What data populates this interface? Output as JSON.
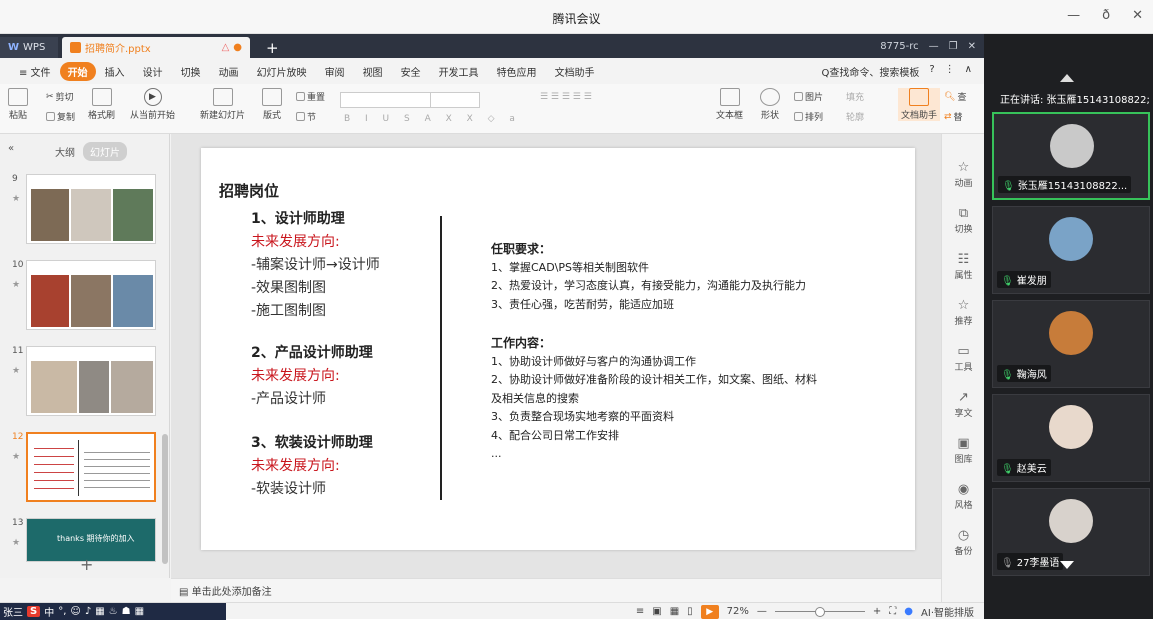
{
  "window": {
    "title": "腾讯会议",
    "controls": [
      "—",
      "ð",
      "✕"
    ]
  },
  "wps": {
    "app_tab": "WPS",
    "doc_tab": "招聘简介.pptx",
    "new_tab": "+",
    "tabbar_right": [
      "8775-rc",
      "—",
      "❐",
      "✕"
    ],
    "menu": [
      "≡ 文件",
      "开始",
      "插入",
      "设计",
      "切换",
      "动画",
      "幻灯片放映",
      "审阅",
      "视图",
      "安全",
      "开发工具",
      "特色应用",
      "文档助手"
    ],
    "menu_active": "开始",
    "menu_right": [
      "Q查找命令、搜索模板",
      "?",
      "⋮",
      "∧"
    ],
    "ribbon": {
      "paste": "粘贴",
      "cut": "剪切",
      "copy": "复制",
      "format_painter": "格式刷",
      "from_current": "从当前开始",
      "new_slide": "新建幻灯片",
      "layout": "版式",
      "section": "节",
      "reset": "重置",
      "text_box": "文本框",
      "shape": "形状",
      "picture": "图片",
      "arrange": "排列",
      "fill": "填充",
      "outline": "轮廓",
      "doc_assistant": "文档助手",
      "find": "查",
      "replace": "替"
    },
    "left_panel": {
      "collapse": "«",
      "outline_label": "大纲",
      "slides_label": "幻灯片",
      "slides": [
        {
          "num": "9",
          "star": "★"
        },
        {
          "num": "10",
          "star": "★"
        },
        {
          "num": "11",
          "star": "★"
        },
        {
          "num": "12",
          "star": "★",
          "selected": true
        },
        {
          "num": "13",
          "star": "★",
          "thumb_text": "thanks 期待你的加入"
        }
      ],
      "add": "+"
    },
    "slide": {
      "title": "招聘岗位",
      "jobs": [
        {
          "heading": "1、设计师助理",
          "direction": "未来发展方向:",
          "items": [
            "-辅案设计师→设计师",
            "-效果图制图",
            "-施工图制图"
          ]
        },
        {
          "heading": "2、产品设计师助理",
          "direction": "未来发展方向:",
          "items": [
            "-产品设计师"
          ]
        },
        {
          "heading": "3、软装设计师助理",
          "direction": "未来发展方向:",
          "items": [
            "-软装设计师"
          ]
        }
      ],
      "requirements": {
        "heading": "任职要求：",
        "items": [
          "1、掌握CAD\\PS等相关制图软件",
          "2、热爱设计，学习态度认真，有接受能力，沟通能力及执行能力",
          "3、责任心强，吃苦耐劳，能适应加班"
        ]
      },
      "work": {
        "heading": "工作内容：",
        "items": [
          "1、协助设计师做好与客户的沟通协调工作",
          "2、协助设计师做好准备阶段的设计相关工作，如文案、图纸、材料",
          "及相关信息的搜索",
          "3、负责整合现场实地考察的平面资料",
          "4、配合公司日常工作安排",
          "..."
        ]
      }
    },
    "notes_placeholder": "单击此处添加备注",
    "right_tools": [
      "动画",
      "切换",
      "属性",
      "推荐",
      "工具",
      "享文",
      "图库",
      "风格",
      "备份"
    ],
    "status": {
      "ime_name": "张三",
      "ime_items": [
        "中",
        "°,",
        "☺",
        "♪",
        "▦",
        "♨",
        "☗",
        "▦"
      ],
      "zoom": "72%",
      "ai": "AI·智能排版"
    }
  },
  "meeting": {
    "speaking": "正在讲话: 张玉雁15143108822;",
    "participants": [
      {
        "name": "张玉雁15143108822...",
        "active": true,
        "avatar_color": "#c9c9c9"
      },
      {
        "name": "崔发朋",
        "avatar_color": "#7aa3c7"
      },
      {
        "name": "鞠海风",
        "avatar_color": "#c77c3a"
      },
      {
        "name": "赵美云",
        "avatar_color": "#e8d9cc"
      },
      {
        "name": "27李墨语",
        "avatar_color": "#d8d2cc"
      }
    ]
  }
}
